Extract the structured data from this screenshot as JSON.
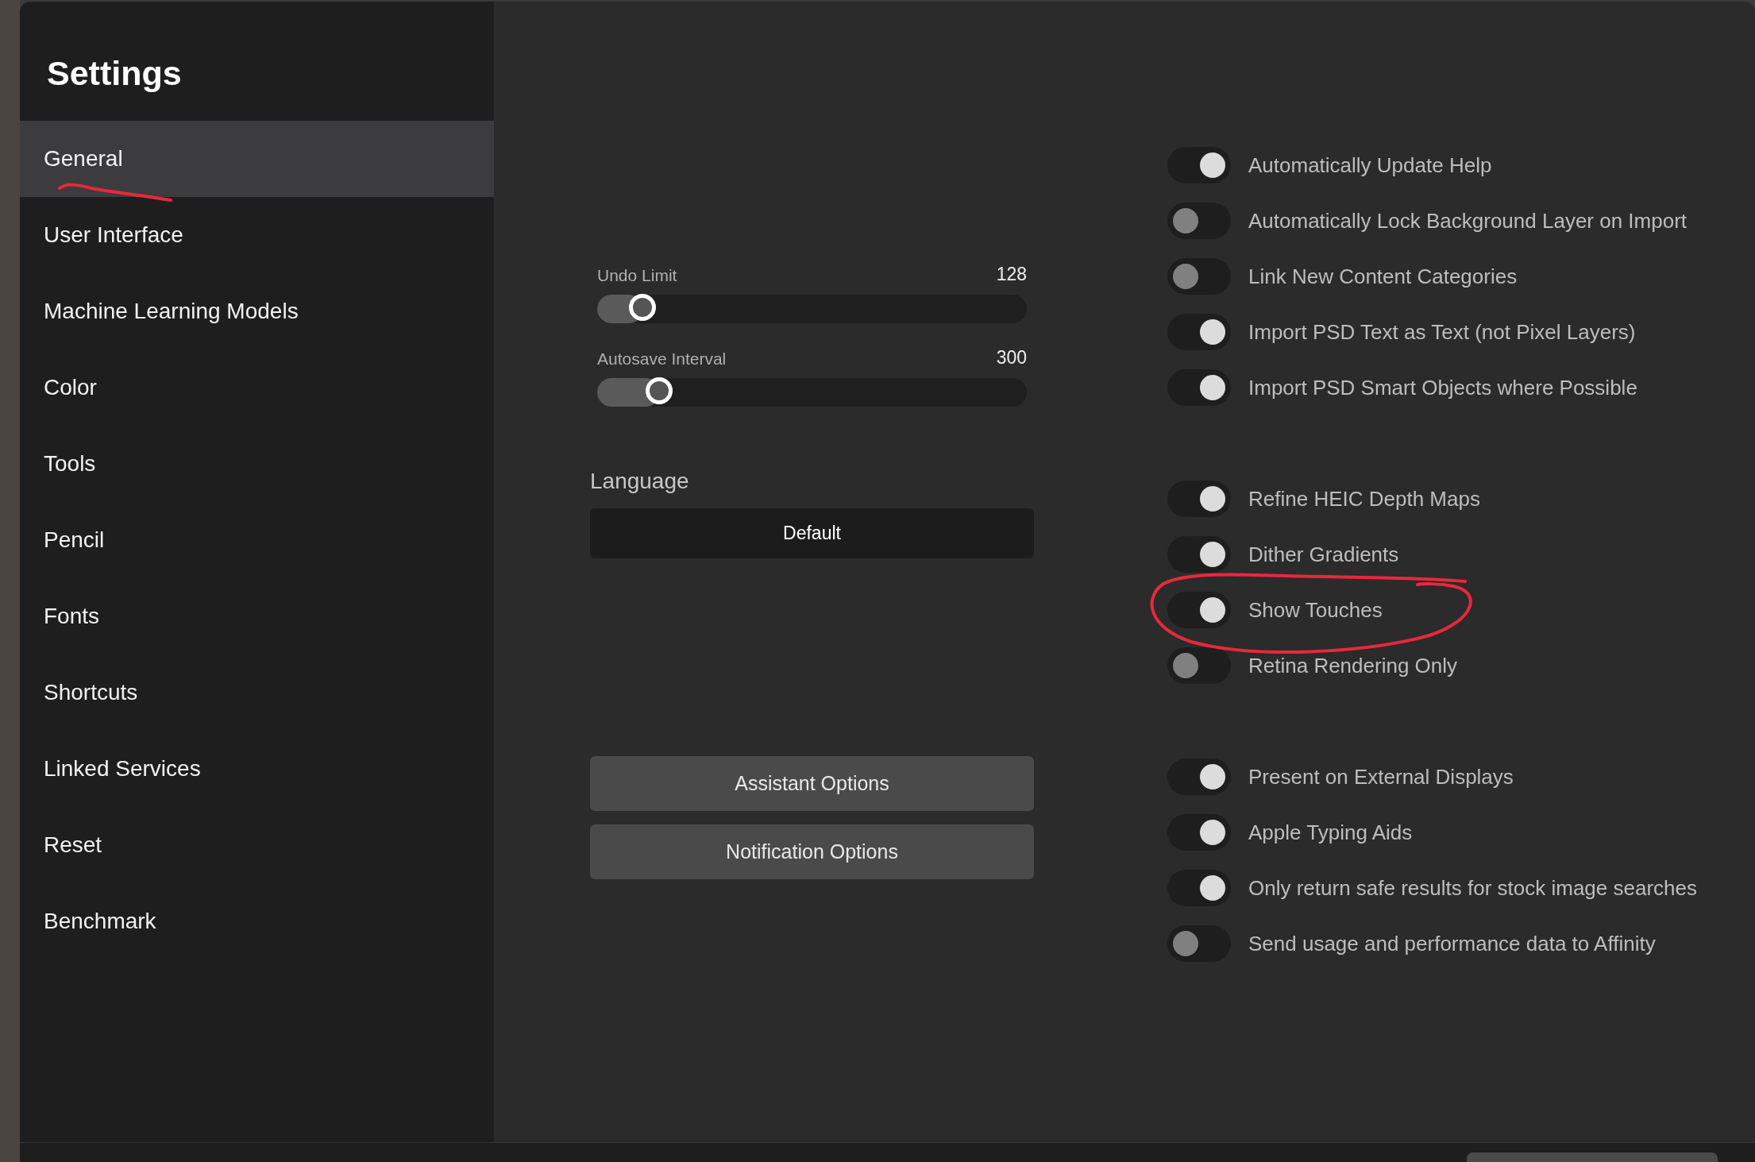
{
  "window": {
    "title": "Settings"
  },
  "sidebar": {
    "items": [
      {
        "label": "General",
        "selected": true
      },
      {
        "label": "User Interface",
        "selected": false
      },
      {
        "label": "Machine Learning Models",
        "selected": false
      },
      {
        "label": "Color",
        "selected": false
      },
      {
        "label": "Tools",
        "selected": false
      },
      {
        "label": "Pencil",
        "selected": false
      },
      {
        "label": "Fonts",
        "selected": false
      },
      {
        "label": "Shortcuts",
        "selected": false
      },
      {
        "label": "Linked Services",
        "selected": false
      },
      {
        "label": "Reset",
        "selected": false
      },
      {
        "label": "Benchmark",
        "selected": false
      }
    ]
  },
  "sliders": [
    {
      "label": "Undo Limit",
      "reading": "128",
      "level": 0.08
    },
    {
      "label": "Autosave Interval",
      "reading": "300",
      "level": 0.12
    }
  ],
  "language": {
    "label": "Language",
    "value": "Default"
  },
  "buttons": [
    "Assistant Options",
    "Notification Options"
  ],
  "toggle_groups": [
    {
      "items": [
        {
          "label": "Automatically Update Help",
          "on": true
        },
        {
          "label": "Automatically Lock Background Layer on Import",
          "on": false
        },
        {
          "label": "Link New Content Categories",
          "on": false
        },
        {
          "label": "Import PSD Text as Text (not Pixel Layers)",
          "on": true
        },
        {
          "label": "Import PSD Smart Objects where Possible",
          "on": true
        }
      ]
    },
    {
      "items": [
        {
          "label": "Refine HEIC Depth Maps",
          "on": true
        },
        {
          "label": "Dither Gradients",
          "on": true
        },
        {
          "label": "Show Touches",
          "on": true
        },
        {
          "label": "Retina Rendering Only",
          "on": false
        }
      ]
    },
    {
      "items": [
        {
          "label": "Present on External Displays",
          "on": true
        },
        {
          "label": "Apple Typing Aids",
          "on": true
        },
        {
          "label": "Only return safe results for stock image searches",
          "on": true
        },
        {
          "label": "Send usage and performance data to Affinity",
          "on": false
        }
      ]
    }
  ]
}
